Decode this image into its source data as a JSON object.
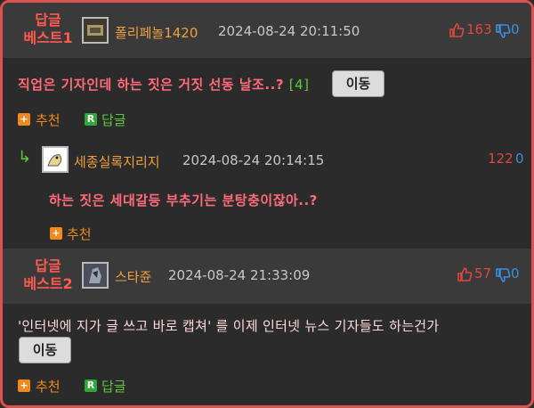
{
  "comments": [
    {
      "best_label_1": "답글",
      "best_label_2": "베스트1",
      "nickname": "폴리페놀1420",
      "date": "2024-08-24 20:11:50",
      "up_count": "163",
      "down_count": "0",
      "text": "직업은 기자인데 하는 짓은 거짓 선동 날조..?",
      "reply_ref": "[4]",
      "move_label": "이동",
      "recommend_label": "추천",
      "reply_label": "답글"
    },
    {
      "best_label_1": "답글",
      "best_label_2": "베스트2",
      "nickname": "스타쥰",
      "date": "2024-08-24 21:33:09",
      "up_count": "57",
      "down_count": "0",
      "text": "'인터넷에 지가 글 쓰고 바로 캡쳐' 를 이제 인터넷 뉴스 기자들도 하는건가",
      "move_label": "이동",
      "recommend_label": "추천",
      "reply_label": "답글"
    }
  ],
  "reply": {
    "nickname": "세종실록지리지",
    "date": "2024-08-24 20:14:15",
    "up_count": "122",
    "down_count": "0",
    "text": "하는 짓은 세대갈등 부추기는 분탕충이잖아..?",
    "recommend_label": "추천"
  },
  "badges": {
    "recommend": "+",
    "reply": "R"
  },
  "reply_arrow": "↳",
  "colors": {
    "accent_red": "#ff5a4f",
    "nickname_orange": "#f0a040",
    "up_red": "#e0463f",
    "down_blue": "#3b8ee0",
    "reply_green": "#5ec73a"
  },
  "icons": [
    "thumbs-up-icon",
    "thumbs-down-icon",
    "plus-badge-icon",
    "reply-badge-icon",
    "reply-arrow-icon"
  ]
}
